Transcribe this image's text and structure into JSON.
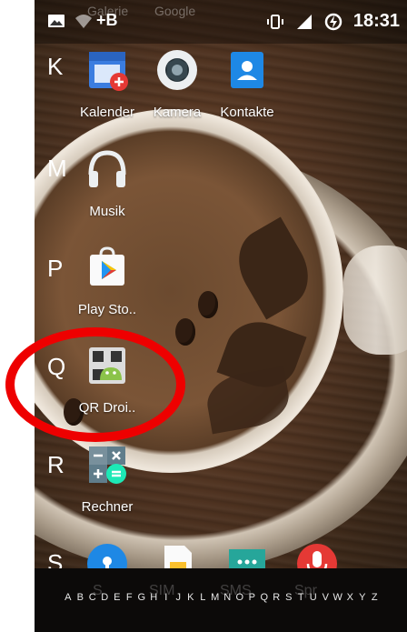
{
  "statusbar": {
    "time": "18:31",
    "ghost_labels": [
      "Galerie",
      "Google"
    ],
    "icons": [
      "image-icon",
      "wifi-icon",
      "plus-b-icon",
      "vibrate-icon",
      "signal-icon",
      "battery-charging-icon"
    ]
  },
  "sections": [
    {
      "letter": "K"
    },
    {
      "letter": "M"
    },
    {
      "letter": "P"
    },
    {
      "letter": "Q"
    },
    {
      "letter": "R"
    },
    {
      "letter": "S"
    }
  ],
  "apps": {
    "kalender": {
      "label": "Kalender",
      "icon": "calendar-icon"
    },
    "kamera": {
      "label": "Kamera",
      "icon": "camera-icon"
    },
    "kontakte": {
      "label": "Kontakte",
      "icon": "contacts-icon"
    },
    "musik": {
      "label": "Musik",
      "icon": "headphones-icon"
    },
    "play_store": {
      "label": "Play Sto..",
      "icon": "play-store-icon"
    },
    "qr_droid": {
      "label": "QR Droi..",
      "icon": "qr-droid-icon"
    },
    "rechner": {
      "label": "Rechner",
      "icon": "calculator-icon"
    },
    "s_row": [
      {
        "icon": "keyhole-icon"
      },
      {
        "icon": "sim-card-icon"
      },
      {
        "icon": "message-icon"
      },
      {
        "icon": "microphone-icon"
      }
    ]
  },
  "alphabet": {
    "letters": [
      "A",
      "B",
      "C",
      "D",
      "E",
      "F",
      "G",
      "H",
      "I",
      "J",
      "K",
      "L",
      "M",
      "N",
      "O",
      "P",
      "Q",
      "R",
      "S",
      "T",
      "U",
      "V",
      "W",
      "X",
      "Y",
      "Z"
    ],
    "ghost_labels": [
      "S",
      "SIM",
      "SMS",
      "Spr"
    ]
  },
  "colors": {
    "highlight": "#ee0000",
    "calendar_blue": "#3b7de0",
    "calendar_badge": "#e53935",
    "contacts_blue": "#1e88e5",
    "play_green": "#00c853",
    "calculator_teal": "#1de9b6",
    "message_teal": "#26a69a",
    "mic_red": "#e53935"
  }
}
